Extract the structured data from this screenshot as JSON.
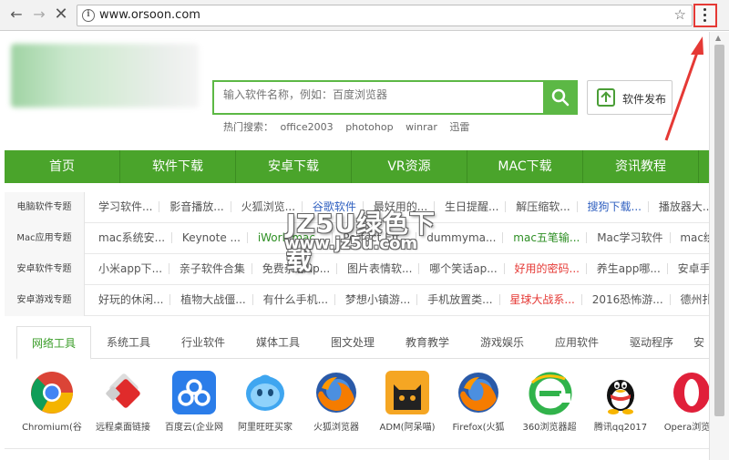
{
  "browser": {
    "url": "www.orsoon.com",
    "back_icon": "arrow-left-icon",
    "forward_icon": "arrow-right-icon",
    "stop_icon": "close-icon",
    "info_icon": "info-icon",
    "bookmark_icon": "star-icon",
    "menu_icon": "vertical-dots-icon",
    "highlight_color": "#e53935"
  },
  "header": {
    "search_placeholder": "输入软件名称，例如：百度浏览器",
    "hot_label": "热门搜索：",
    "hot_terms": [
      "office2003",
      "photohop",
      "winrar",
      "迅雷"
    ],
    "publish_label": "软件发布"
  },
  "nav": {
    "items": [
      "首页",
      "软件下载",
      "安卓下载",
      "VR资源",
      "MAC下载",
      "资讯教程"
    ],
    "color": "#4aa42b"
  },
  "categories": [
    {
      "head": "电脑软件专题",
      "links": [
        "学习软件...",
        "影音播放...",
        "火狐浏览...",
        "谷歌软件",
        "最好用的...",
        "生日提醒...",
        "解压缩软...",
        "搜狗下载...",
        "播放器大..."
      ]
    },
    {
      "head": "Mac应用专题",
      "links": [
        "mac系统安...",
        "Keynote ...",
        "iWork mac...",
        "Perfect Eff...",
        "dummyma...",
        "mac五笔输...",
        "Mac学习软件",
        "mac绘画工..."
      ]
    },
    {
      "head": "安卓软件专题",
      "links": [
        "小米app下...",
        "亲子软件合集",
        "免费杂志ap...",
        "图片表情软...",
        "哪个笑话ap...",
        "好用的密码...",
        "养生app哪...",
        "安卓手机..."
      ]
    },
    {
      "head": "安卓游戏专题",
      "links": [
        "好玩的休闲...",
        "植物大战僵...",
        "有什么手机...",
        "梦想小镇游...",
        "手机放置类...",
        "星球大战系...",
        "2016恐怖游...",
        "德州扑克..."
      ]
    }
  ],
  "watermark": {
    "line1": "JZ5U绿色下载",
    "line2": "www.jz5u.com"
  },
  "tabs": [
    "网络工具",
    "系统工具",
    "行业软件",
    "媒体工具",
    "图文处理",
    "教育教学",
    "游戏娱乐",
    "应用软件",
    "驱动程序",
    "安"
  ],
  "apps": [
    {
      "label": "Chromium(谷",
      "icon": "chromium-icon"
    },
    {
      "label": "远程桌面链接",
      "icon": "remote-desktop-icon"
    },
    {
      "label": "百度云(企业网",
      "icon": "baidu-cloud-icon"
    },
    {
      "label": "阿里旺旺买家",
      "icon": "aliwangwang-icon"
    },
    {
      "label": "火狐浏览器",
      "icon": "firefox-icon"
    },
    {
      "label": "ADM(阿呆喵)",
      "icon": "adm-cat-icon"
    },
    {
      "label": "Firefox(火狐",
      "icon": "firefox-icon"
    },
    {
      "label": "360浏览器超",
      "icon": "360-browser-icon"
    },
    {
      "label": "腾讯qq2017",
      "icon": "qq-penguin-icon"
    },
    {
      "label": "Opera浏览器",
      "icon": "opera-icon"
    }
  ]
}
